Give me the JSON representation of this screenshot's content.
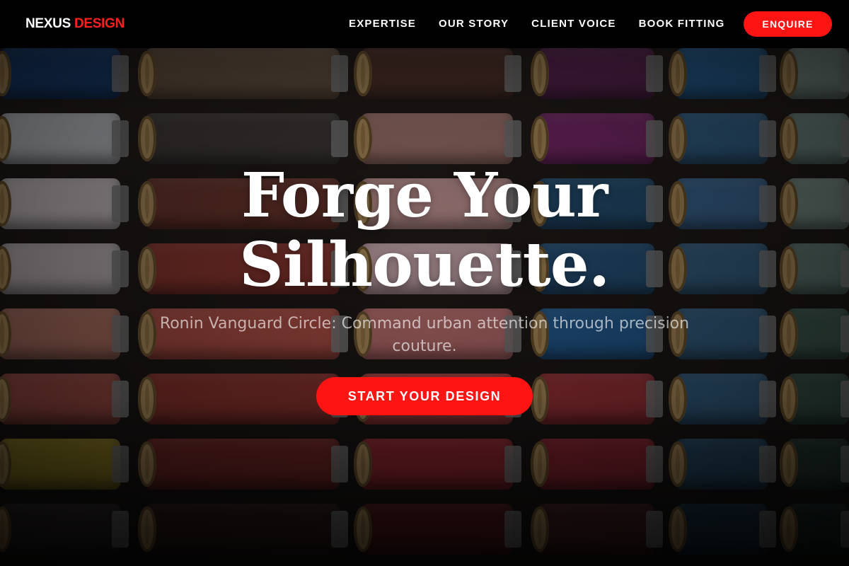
{
  "brand": {
    "name_primary": "NEXUS",
    "name_accent": "DESIGN",
    "accent_color": "#ff1414"
  },
  "nav": {
    "items": [
      {
        "label": "EXPERTISE"
      },
      {
        "label": "OUR STORY"
      },
      {
        "label": "CLIENT VOICE"
      },
      {
        "label": "BOOK FITTING"
      }
    ],
    "cta_label": "ENQUIRE"
  },
  "hero": {
    "headline": "Forge Your Silhouette.",
    "subtitle": "Ronin Vanguard Circle: Command urban attention through precision couture.",
    "cta_label": "START YOUR DESIGN"
  }
}
